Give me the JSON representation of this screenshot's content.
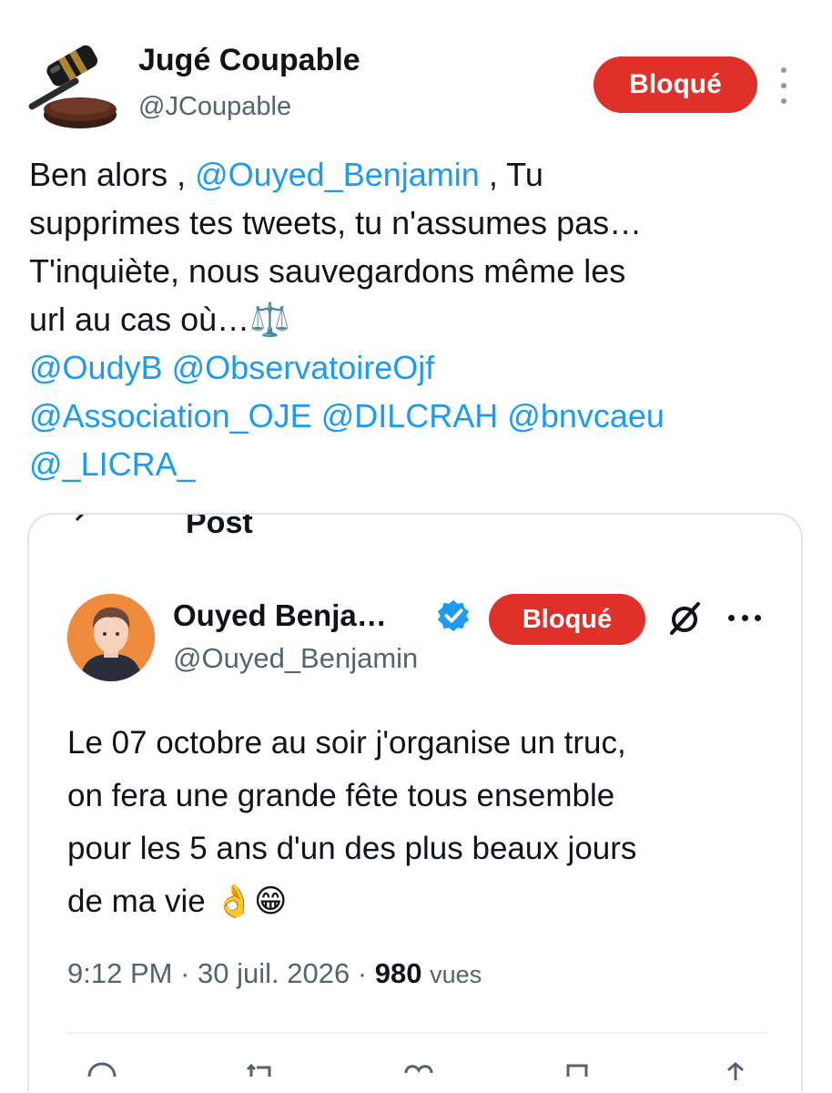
{
  "author": {
    "display_name": "Jugé Coupable",
    "handle": "@JCoupable",
    "avatar_icon": "gavel-icon",
    "blocked_label": "Bloqué"
  },
  "tweet": {
    "t1": "Ben alors , ",
    "m1": "@Ouyed_Benjamin",
    "t2": " , Tu",
    "l2": "supprimes tes tweets, tu n'assumes pas…",
    "l3": "T'inquiète, nous sauvegardons même les",
    "l4": "url au cas où…⚖️",
    "m2": "@OudyB",
    "m3": "@ObservatoireOjf",
    "m4": "@Association_OJE",
    "m5": "@DILCRAH",
    "m6": "@bnvcaeu",
    "m7": "@_LICRA_"
  },
  "quote": {
    "partial_header": "Post",
    "display_name": "Ouyed Benja…",
    "handle": "@Ouyed_Benjamin",
    "blocked_label": "Bloqué",
    "verified_icon": "verified-badge-icon",
    "b1": "Le 07 octobre au soir j'organise un truc,",
    "b2": "on fera une grande fête tous ensemble",
    "b3": "pour les 5 ans d'un des plus beaux jours",
    "b4": "de ma vie 👌😁",
    "time": "9:12 PM",
    "sep": "·",
    "date": "30 juil. 2026",
    "views_count": "980",
    "views_label": "vues"
  },
  "colors": {
    "blocked": "#e0302a",
    "mention": "#1d9bf0",
    "secondary_text": "#536471",
    "verified": "#1d9bf0"
  }
}
